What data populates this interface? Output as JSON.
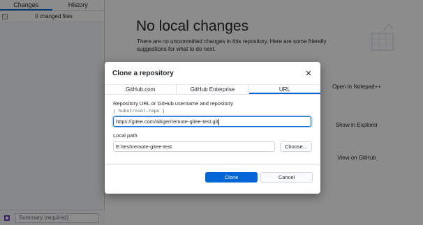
{
  "sidebar": {
    "tabs": [
      "Changes",
      "History"
    ],
    "changed_files": "0 changed files",
    "summary_placeholder": "Summary (required)"
  },
  "main": {
    "title": "No local changes",
    "description": "There are no uncommitted changes in this repository. Here are some friendly suggestions for what to do next.",
    "actions": [
      "Open in Notepad++",
      "Show in Explorer",
      "View on GitHub"
    ]
  },
  "dialog": {
    "title": "Clone a repository",
    "tabs": [
      "GitHub.com",
      "GitHub Enterprise",
      "URL"
    ],
    "active_tab": "URL",
    "url_label": "Repository URL or GitHub username and repository",
    "url_hint": "( hubot/cool-repo )",
    "url_value": "https://gitee.com/aitiger/remote-gitee-test.git",
    "path_label": "Local path",
    "path_value": "E:\\test\\remote-gitee-test",
    "choose_label": "Choose...",
    "clone_label": "Clone",
    "cancel_label": "Cancel"
  },
  "colors": {
    "accent": "#0366d6",
    "overlay": "#000000"
  }
}
